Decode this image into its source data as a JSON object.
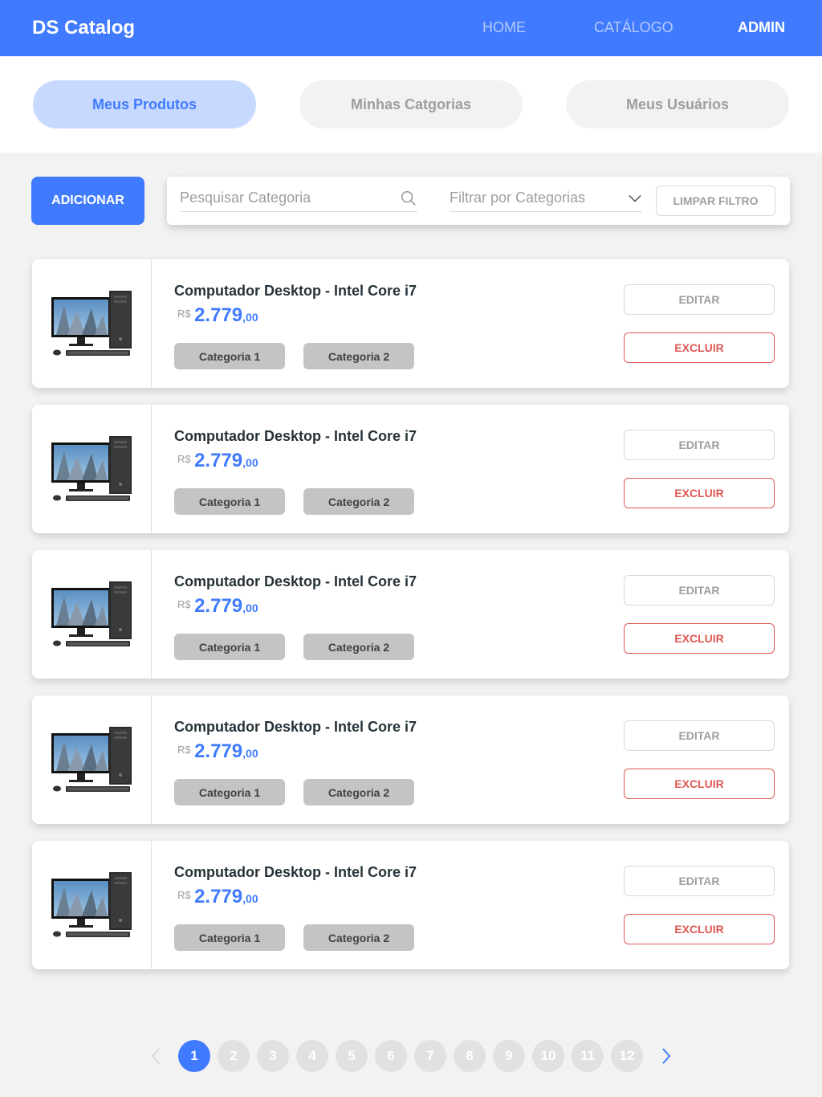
{
  "navbar": {
    "brand": "DS Catalog",
    "links": [
      {
        "label": "HOME",
        "active": false
      },
      {
        "label": "CATÁLOGO",
        "active": false
      },
      {
        "label": "ADMIN",
        "active": true
      }
    ]
  },
  "admin_tabs": [
    {
      "label": "Meus Produtos",
      "active": true
    },
    {
      "label": "Minhas Catgorias",
      "active": false
    },
    {
      "label": "Meus Usuários",
      "active": false
    }
  ],
  "filter": {
    "add_label": "ADICIONAR",
    "search_placeholder": "Pesquisar Categoria",
    "category_placeholder": "Filtrar por Categorias",
    "clear_label": "LIMPAR FILTRO"
  },
  "products": [
    {
      "name": "Computador Desktop - Intel Core i7",
      "currency": "R$",
      "price_int": "2.779",
      "price_dec": ",00",
      "categories": [
        "Categoria 1",
        "Categoria 2"
      ],
      "edit_label": "EDITAR",
      "delete_label": "EXCLUIR"
    },
    {
      "name": "Computador Desktop - Intel Core i7",
      "currency": "R$",
      "price_int": "2.779",
      "price_dec": ",00",
      "categories": [
        "Categoria 1",
        "Categoria 2"
      ],
      "edit_label": "EDITAR",
      "delete_label": "EXCLUIR"
    },
    {
      "name": "Computador Desktop - Intel Core i7",
      "currency": "R$",
      "price_int": "2.779",
      "price_dec": ",00",
      "categories": [
        "Categoria 1",
        "Categoria 2"
      ],
      "edit_label": "EDITAR",
      "delete_label": "EXCLUIR"
    },
    {
      "name": "Computador Desktop - Intel Core i7",
      "currency": "R$",
      "price_int": "2.779",
      "price_dec": ",00",
      "categories": [
        "Categoria 1",
        "Categoria 2"
      ],
      "edit_label": "EDITAR",
      "delete_label": "EXCLUIR"
    },
    {
      "name": "Computador Desktop - Intel Core i7",
      "currency": "R$",
      "price_int": "2.779",
      "price_dec": ",00",
      "categories": [
        "Categoria 1",
        "Categoria 2"
      ],
      "edit_label": "EDITAR",
      "delete_label": "EXCLUIR"
    }
  ],
  "pagination": {
    "pages": [
      "1",
      "2",
      "3",
      "4",
      "5",
      "6",
      "7",
      "8",
      "9",
      "10",
      "11",
      "12"
    ],
    "active_page": "1"
  },
  "colors": {
    "primary": "#407bff",
    "danger": "#df5753",
    "active_tab_bg": "#c8d9ff"
  },
  "icons": {
    "search": "search-icon",
    "dropdown": "chevron-down-icon",
    "prev": "chevron-left-icon",
    "next": "chevron-right-icon",
    "product_image": "desktop-computer-image"
  }
}
